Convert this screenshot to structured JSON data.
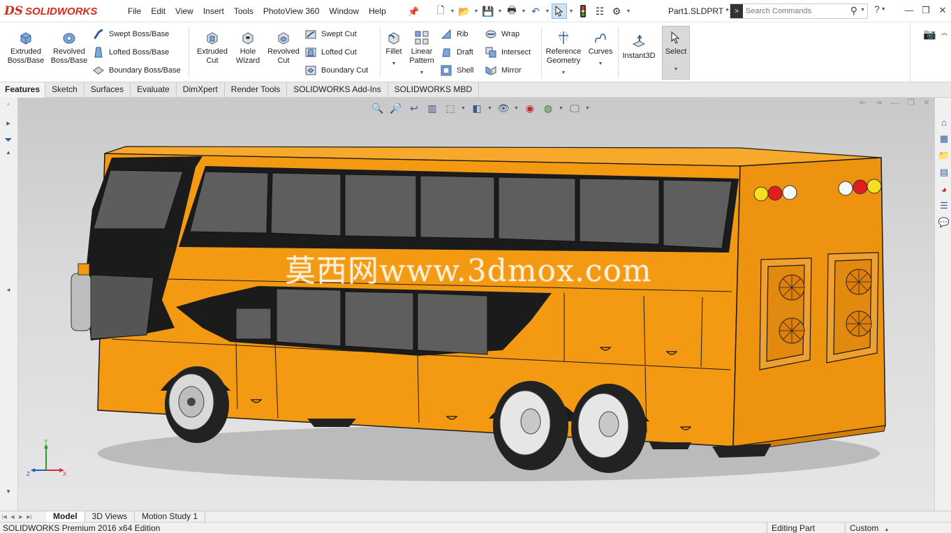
{
  "app": {
    "logo_text": "SOLIDWORKS",
    "logo_mark": "DS",
    "document": "Part1.SLDPRT *"
  },
  "menu": [
    "File",
    "Edit",
    "View",
    "Insert",
    "Tools",
    "PhotoView 360",
    "Window",
    "Help"
  ],
  "search": {
    "placeholder": "Search Commands"
  },
  "ribbon": {
    "extruded_boss": "Extruded Boss/Base",
    "revolved_boss": "Revolved Boss/Base",
    "swept_boss": "Swept Boss/Base",
    "lofted_boss": "Lofted Boss/Base",
    "boundary_boss": "Boundary Boss/Base",
    "extruded_cut": "Extruded Cut",
    "hole_wizard": "Hole Wizard",
    "revolved_cut": "Revolved Cut",
    "swept_cut": "Swept Cut",
    "lofted_cut": "Lofted Cut",
    "boundary_cut": "Boundary Cut",
    "fillet": "Fillet",
    "linear_pattern": "Linear Pattern",
    "rib": "Rib",
    "draft": "Draft",
    "shell": "Shell",
    "wrap": "Wrap",
    "intersect": "Intersect",
    "mirror": "Mirror",
    "reference_geometry": "Reference Geometry",
    "curves": "Curves",
    "instant3d": "Instant3D",
    "select": "Select"
  },
  "tabs": [
    "Features",
    "Sketch",
    "Surfaces",
    "Evaluate",
    "DimXpert",
    "Render Tools",
    "SOLIDWORKS Add-Ins",
    "SOLIDWORKS MBD"
  ],
  "viewport": {
    "watermark": "莫西网www.3dmox.com",
    "triad": {
      "x": "X",
      "y": "Y",
      "z": "Z"
    }
  },
  "bottom_tabs": [
    "Model",
    "3D Views",
    "Motion Study 1"
  ],
  "status": {
    "edition": "SOLIDWORKS Premium 2016 x64 Edition",
    "mode": "Editing Part",
    "units": "Custom"
  },
  "colors": {
    "bus_body": "#f39a12",
    "brand_red": "#d52b1e",
    "accent_blue": "#2f5f97"
  }
}
